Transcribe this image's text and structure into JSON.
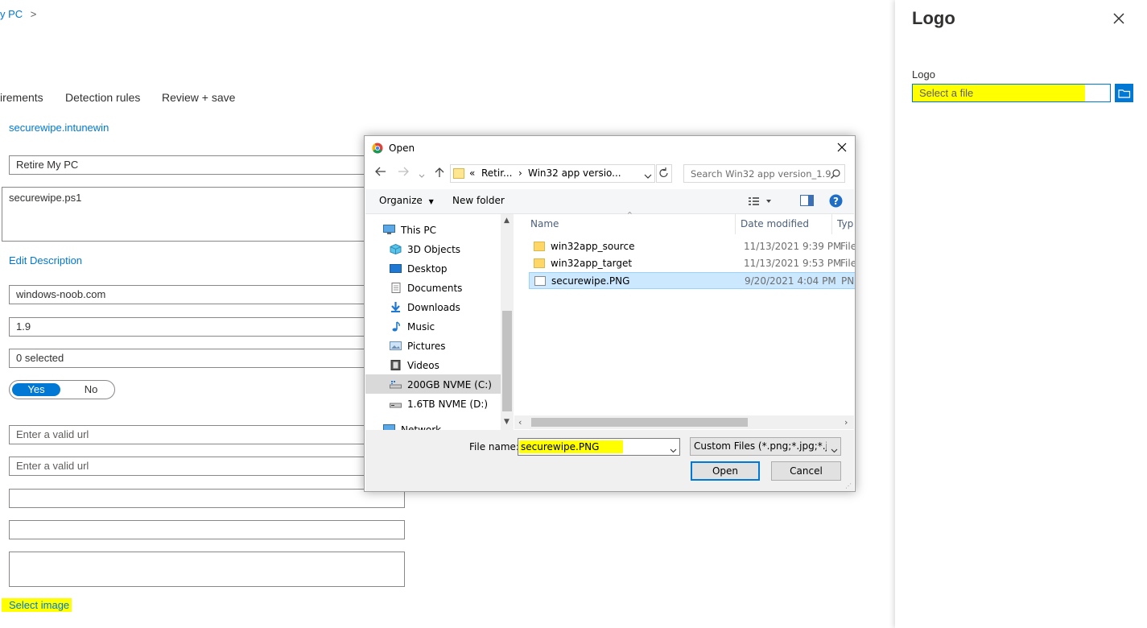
{
  "breadcrumb": {
    "text": "y PC",
    "chevron": ">"
  },
  "tabs": [
    "irements",
    "Detection rules",
    "Review + save"
  ],
  "form": {
    "package_file": "securewipe.intunewin",
    "name": "Retire My PC",
    "description": "securewipe.ps1",
    "edit_description": "Edit Description",
    "publisher": "windows-noob.com",
    "version": "1.9",
    "category": "0 selected",
    "toggle_yes": "Yes",
    "toggle_no": "No",
    "url1_placeholder": "Enter a valid url",
    "url2_placeholder": "Enter a valid url",
    "select_image": "Select image"
  },
  "logo_panel": {
    "title": "Logo",
    "field_label": "Logo",
    "file_placeholder": "Select a file"
  },
  "dialog": {
    "title": "Open",
    "path": {
      "prefix": "«",
      "seg1": "Retir...",
      "seg2": "Win32 app versio..."
    },
    "search_placeholder": "Search Win32 app version_1.9",
    "organize": "Organize",
    "new_folder": "New folder",
    "nav_items": [
      {
        "label": "This PC",
        "icon": "computer-icon"
      },
      {
        "label": "3D Objects",
        "icon": "cube-icon"
      },
      {
        "label": "Desktop",
        "icon": "desktop-icon"
      },
      {
        "label": "Documents",
        "icon": "document-icon"
      },
      {
        "label": "Downloads",
        "icon": "download-icon"
      },
      {
        "label": "Music",
        "icon": "music-icon"
      },
      {
        "label": "Pictures",
        "icon": "picture-icon"
      },
      {
        "label": "Videos",
        "icon": "video-icon"
      },
      {
        "label": "200GB NVME (C:)",
        "icon": "drive-icon"
      },
      {
        "label": "1.6TB NVME (D:)",
        "icon": "drive-icon"
      },
      {
        "label": "Network",
        "icon": "network-icon"
      }
    ],
    "columns": {
      "name": "Name",
      "date": "Date modified",
      "type": "Type"
    },
    "files": [
      {
        "name": "win32app_source",
        "date": "11/13/2021 9:39 PM",
        "type": "File",
        "kind": "folder"
      },
      {
        "name": "win32app_target",
        "date": "11/13/2021 9:53 PM",
        "type": "File",
        "kind": "folder"
      },
      {
        "name": "securewipe.PNG",
        "date": "9/20/2021 4:04 PM",
        "type": "PNG",
        "kind": "image"
      }
    ],
    "file_name_label": "File name:",
    "file_name_value": "securewipe.PNG",
    "filter": "Custom Files (*.png;*.jpg;*.jpeg",
    "open_btn": "Open",
    "cancel_btn": "Cancel"
  },
  "colors": {
    "accent": "#0078d4",
    "highlight": "#ffff00",
    "selection": "#cce8ff"
  }
}
